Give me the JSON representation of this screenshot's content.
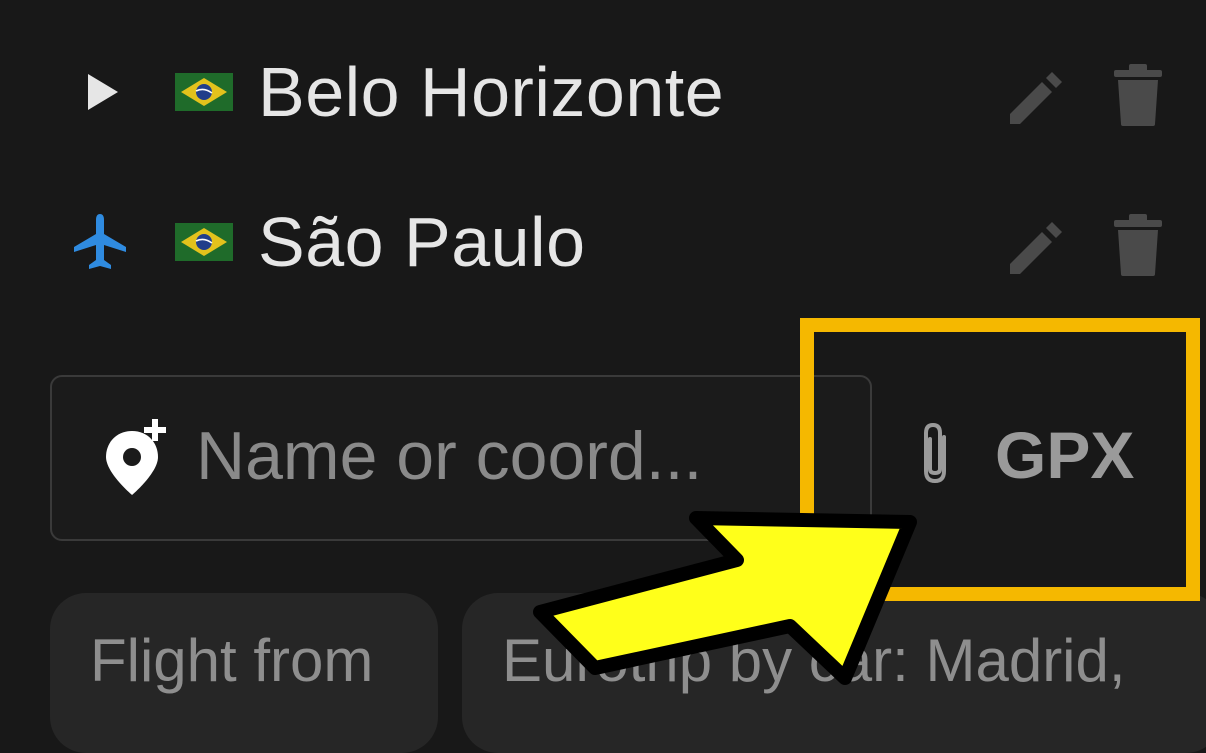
{
  "places": [
    {
      "name": "Belo Horizonte",
      "lead_icon": "play-triangle-icon",
      "flag": "brazil-flag-icon"
    },
    {
      "name": "São Paulo",
      "lead_icon": "airplane-icon",
      "flag": "brazil-flag-icon"
    }
  ],
  "search": {
    "placeholder": "Name or coord...",
    "value": ""
  },
  "gpx_button": {
    "label": "GPX",
    "icon": "paperclip-icon"
  },
  "suggestions": [
    {
      "label": "Flight from"
    },
    {
      "label": "Eurotrip by car: Madrid,"
    }
  ],
  "colors": {
    "background": "#181818",
    "text": "#e6e6e6",
    "muted": "#8a8a8a",
    "icon_muted": "#4a4a4a",
    "airplane": "#2f8be0",
    "highlight": "#f5b800",
    "arrow": "#ffff1a"
  }
}
